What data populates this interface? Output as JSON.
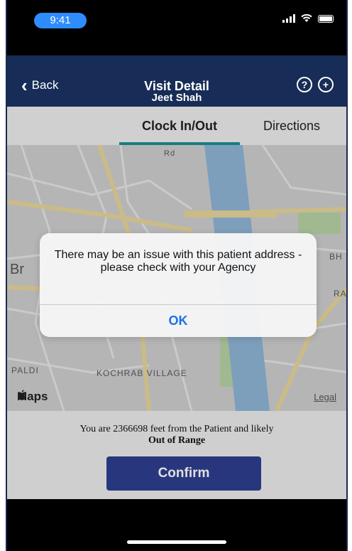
{
  "status_bar": {
    "time": "9:41"
  },
  "nav": {
    "back_label": "Back",
    "title": "Visit Detail",
    "subtitle": "Jeet Shah",
    "help_glyph": "?",
    "add_glyph": "+"
  },
  "tabs": [
    {
      "label": "Clock In/Out",
      "active": true
    },
    {
      "label": "Directions",
      "active": false
    }
  ],
  "map": {
    "labels": {
      "left_edge": "Br",
      "right_top": "BH",
      "right_mid": "RA",
      "paldi": "PALDI",
      "kochrab": "KOCHRAB VILLAGE",
      "road": "Rd"
    },
    "logo_text": "Maps",
    "legal_label": "Legal"
  },
  "footer": {
    "distance_text": "You are 2366698 feet from the Patient and likely",
    "range_text": "Out of Range",
    "confirm_label": "Confirm"
  },
  "alert": {
    "message": "There may be an issue with this patient address - please check with your Agency",
    "ok_label": "OK"
  },
  "colors": {
    "nav_background": "#172d57",
    "tab_underline": "#1d8f8f",
    "confirm_button": "#2e3f8f",
    "ok_text": "#1a73e8",
    "time_pill": "#2f8cff"
  },
  "icons": {
    "back": "chevron-left-icon",
    "help": "question-circle-icon",
    "add": "plus-circle-icon",
    "signal": "cellular-signal-icon",
    "wifi": "wifi-icon",
    "battery": "battery-icon",
    "apple": "apple-logo-icon"
  }
}
